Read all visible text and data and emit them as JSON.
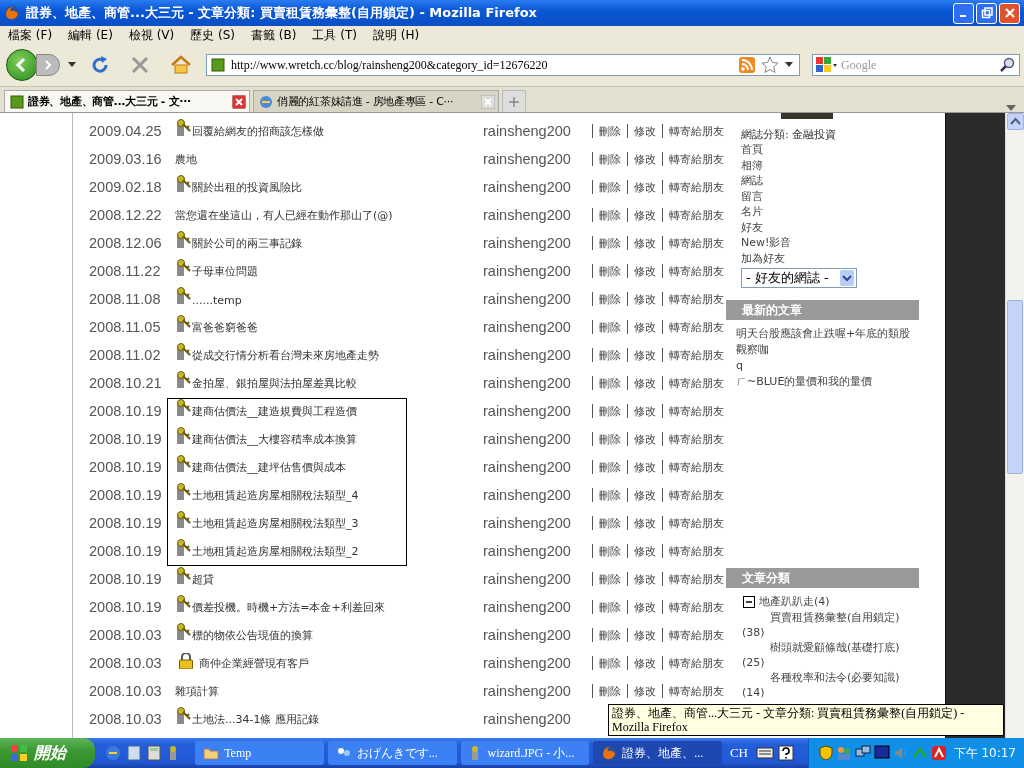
{
  "window": {
    "title": "證券、地產、商管...大三元 - 文章分類: 買賣租賃務彙整(自用鎖定) - Mozilla Firefox"
  },
  "menu": [
    "檔案 (F)",
    "編輯 (E)",
    "檢視 (V)",
    "歷史 (S)",
    "書籤 (B)",
    "工具 (T)",
    "說明 (H)"
  ],
  "address": {
    "url": "http://www.wretch.cc/blog/rainsheng200&category_id=12676220"
  },
  "search": {
    "placeholder": "Google"
  },
  "tabs": [
    {
      "label": "證券、地產、商管...大三元 - 文···",
      "selected": true
    },
    {
      "label": "俏麗的紅茶妹請進 - 房地產專區 - C···",
      "selected": false
    }
  ],
  "articles": [
    {
      "date": "2009.04.25",
      "kind": "key",
      "title": "回覆給網友的招商該怎樣做",
      "author": "rainsheng200",
      "actions": [
        "刪除",
        "修改",
        "轉寄給朋友"
      ],
      "boxed": false
    },
    {
      "date": "2009.03.16",
      "kind": "plain",
      "title": "農地",
      "author": "rainsheng200",
      "actions": [
        "刪除",
        "修改",
        "轉寄給朋友"
      ],
      "boxed": false
    },
    {
      "date": "2009.02.18",
      "kind": "key",
      "title": "關於出租的投資風險比",
      "author": "rainsheng200",
      "actions": [
        "刪除",
        "修改",
        "轉寄給朋友"
      ],
      "boxed": false
    },
    {
      "date": "2008.12.22",
      "kind": "plain",
      "title": "當您還在坐這山，有人已經在動作那山了(@)",
      "author": "rainsheng200",
      "actions": [
        "刪除",
        "修改",
        "轉寄給朋友"
      ],
      "boxed": false
    },
    {
      "date": "2008.12.06",
      "kind": "key",
      "title": "關於公司的兩三事記錄",
      "author": "rainsheng200",
      "actions": [
        "刪除",
        "修改",
        "轉寄給朋友"
      ],
      "boxed": false
    },
    {
      "date": "2008.11.22",
      "kind": "key",
      "title": "子母車位問題",
      "author": "rainsheng200",
      "actions": [
        "刪除",
        "修改",
        "轉寄給朋友"
      ],
      "boxed": false
    },
    {
      "date": "2008.11.08",
      "kind": "key",
      "title": "......temp",
      "author": "rainsheng200",
      "actions": [
        "刪除",
        "修改",
        "轉寄給朋友"
      ],
      "boxed": false
    },
    {
      "date": "2008.11.05",
      "kind": "key",
      "title": "富爸爸窮爸爸",
      "author": "rainsheng200",
      "actions": [
        "刪除",
        "修改",
        "轉寄給朋友"
      ],
      "boxed": false
    },
    {
      "date": "2008.11.02",
      "kind": "key",
      "title": "從成交行情分析看台灣未來房地產走勢",
      "author": "rainsheng200",
      "actions": [
        "刪除",
        "修改",
        "轉寄給朋友"
      ],
      "boxed": false
    },
    {
      "date": "2008.10.21",
      "kind": "key",
      "title": "金拍屋、銀拍屋與法拍屋差異比較",
      "author": "rainsheng200",
      "actions": [
        "刪除",
        "修改",
        "轉寄給朋友"
      ],
      "boxed": false
    },
    {
      "date": "2008.10.19",
      "kind": "key",
      "title": "建商估價法__建造規費與工程造價",
      "author": "rainsheng200",
      "actions": [
        "刪除",
        "修改",
        "轉寄給朋友"
      ],
      "boxed": true
    },
    {
      "date": "2008.10.19",
      "kind": "key",
      "title": "建商估價法__大樓容積率成本換算",
      "author": "rainsheng200",
      "actions": [
        "刪除",
        "修改",
        "轉寄給朋友"
      ],
      "boxed": true
    },
    {
      "date": "2008.10.19",
      "kind": "key",
      "title": "建商估價法__建坪估售價與成本",
      "author": "rainsheng200",
      "actions": [
        "刪除",
        "修改",
        "轉寄給朋友"
      ],
      "boxed": true
    },
    {
      "date": "2008.10.19",
      "kind": "key",
      "title": "土地租賃起造房屋相關稅法類型_4",
      "author": "rainsheng200",
      "actions": [
        "刪除",
        "修改",
        "轉寄給朋友"
      ],
      "boxed": true
    },
    {
      "date": "2008.10.19",
      "kind": "key",
      "title": "土地租賃起造房屋相關稅法類型_3",
      "author": "rainsheng200",
      "actions": [
        "刪除",
        "修改",
        "轉寄給朋友"
      ],
      "boxed": true
    },
    {
      "date": "2008.10.19",
      "kind": "key",
      "title": "土地租賃起造房屋相關稅法類型_2",
      "author": "rainsheng200",
      "actions": [
        "刪除",
        "修改",
        "轉寄給朋友"
      ],
      "boxed": true
    },
    {
      "date": "2008.10.19",
      "kind": "key",
      "title": "超貸",
      "author": "rainsheng200",
      "actions": [
        "刪除",
        "修改",
        "轉寄給朋友"
      ],
      "boxed": false
    },
    {
      "date": "2008.10.19",
      "kind": "key",
      "title": "價差投機。時機+方法=本金+利差回來",
      "author": "rainsheng200",
      "actions": [
        "刪除",
        "修改",
        "轉寄給朋友"
      ],
      "boxed": false
    },
    {
      "date": "2008.10.03",
      "kind": "key",
      "title": "標的物依公告現值的換算",
      "author": "rainsheng200",
      "actions": [
        "刪除",
        "修改",
        "轉寄給朋友"
      ],
      "boxed": false
    },
    {
      "date": "2008.10.03",
      "kind": "lock",
      "title": "商仲企業經營現有客戶",
      "author": "rainsheng200",
      "actions": [
        "刪除",
        "修改",
        "轉寄給朋友"
      ],
      "boxed": false
    },
    {
      "date": "2008.10.03",
      "kind": "plain",
      "title": "雜項計算",
      "author": "rainsheng200",
      "actions": [
        "刪除",
        "修改",
        "轉寄給朋友"
      ],
      "boxed": false
    },
    {
      "date": "2008.10.03",
      "kind": "key",
      "title": "土地法...34-1條 應用記錄",
      "author": "rainsheng200",
      "boxed": false
    }
  ],
  "sidebar": {
    "blog_category": "網誌分類: 金融投資",
    "links": [
      "首頁",
      "相簿",
      "網誌",
      "留言",
      "名片",
      "好友",
      "New!影音",
      "加為好友"
    ],
    "friends_select": "- 好友的網誌 -",
    "latest": {
      "heading": "最新的文章",
      "items": [
        "明天台股應該會止跌喔+年底的類股觀察咖",
        "q",
        "ㄏ~BLUE的量價和我的量價"
      ]
    },
    "categories": {
      "heading": "文章分類",
      "tree": [
        {
          "name": "地產趴趴走(4)",
          "expanded": true,
          "children": [
            {
              "name": "買賣租賃務彙整(自用鎖定)",
              "count": "(38)"
            },
            {
              "name": "樹頭就愛顧條哉(基礎打底)",
              "count": "(25)"
            },
            {
              "name": "各種稅率和法令(必要知識)",
              "count": "(14)"
            }
          ]
        }
      ]
    }
  },
  "tooltip": "證券、地產、商管...大三元 - 文章分類: 買賣租賃務彙整(自用鎖定) - Mozilla Firefox",
  "taskbar": {
    "start": "開始",
    "tasks": [
      {
        "label": "Temp",
        "kind": "folder",
        "selected": false
      },
      {
        "label": "おげんきです...",
        "kind": "chat",
        "selected": false
      },
      {
        "label": "wizard.JPG - 小...",
        "kind": "image",
        "selected": false
      },
      {
        "label": "證券、地產、...",
        "kind": "browser",
        "selected": true
      }
    ],
    "language": "CH",
    "clock": "下午 10:17"
  }
}
